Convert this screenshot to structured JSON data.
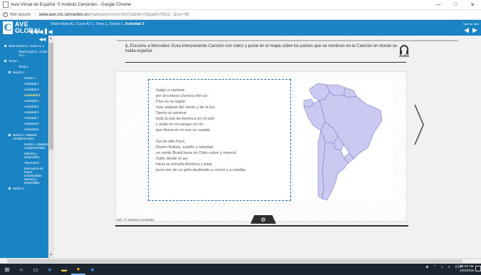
{
  "browser": {
    "window_title": "Aula Virtual de Español. © Instituto Cervantes - Google Chrome",
    "security_label": "Not secure",
    "url_host": "www.ave.cvc.cervantes.es",
    "url_path": "/materiales/visor.htm?admin=0&path=5612...&cur=80"
  },
  "ave": {
    "logo_c": "C",
    "logo_ave": "AVE",
    "logo_global": "GLOBAL",
    "breadcrumb": "Nivel inicial A1, Curso A1 1, Tema 1, Sesión 1,",
    "breadcrumb_current": "Actividad 3",
    "session_label": "Salir de esta"
  },
  "sidebar": {
    "collapse": "◀◀",
    "items": [
      {
        "label": "Nivel inicial A1, Curso A1 1",
        "level": 0
      },
      {
        "label": "Nivel inicial A1, Curso A1 1",
        "level": 2
      },
      {
        "label": "Tema 1",
        "level": 0
      },
      {
        "label": "Tema 1",
        "level": 2
      },
      {
        "label": "Sesión 1",
        "level": 1
      },
      {
        "label": "Sesión 1",
        "level": 3
      },
      {
        "label": "Actividad 1",
        "level": 3
      },
      {
        "label": "Actividad 2",
        "level": 3
      },
      {
        "label": "Actividad 3",
        "level": 3
      },
      {
        "label": "Actividad 4",
        "level": 3
      },
      {
        "label": "Actividad 5",
        "level": 3
      },
      {
        "label": "Actividad 6",
        "level": 3
      },
      {
        "label": "Actividad 7",
        "level": 3
      },
      {
        "label": "Actividad 8",
        "level": 3
      },
      {
        "label": "Actividad 9",
        "level": 3
      },
      {
        "label": "Sesión 1. Material complementario",
        "level": 1
      },
      {
        "label": "Sesión 1. Material complementario",
        "level": 3
      },
      {
        "label": "Saludos y despedidas",
        "level": 3
      },
      {
        "label": "Abecedario",
        "level": 3
      },
      {
        "label": "Entonación de frases exclamativas: saludos y despedidas",
        "level": 3
      },
      {
        "label": "Sesión 2",
        "level": 1
      }
    ]
  },
  "activity": {
    "number": "1.",
    "instruction_a": "Escuche a Mercedes Sosa interpretando",
    "instruction_song": "Canción con todos",
    "instruction_b": "y pulse en el mapa sobre los países que se nombran en la Canción en donde se habla español.",
    "audio_label": "Audio",
    "poem": [
      "Salgo a caminar",
      "por la cintura cósmica del sur.",
      "Piso en la región",
      "más vegetal del viento y de la luz.",
      "Siento al caminar",
      "toda la piel de América en mi piel",
      "y anda en mi sangre un río",
      "que libera en mi voz su caudal.",
      "",
      "Sol de alto Perú,",
      "Rostro Bolivia, estaño y soledad,",
      "un verde Brasil besa mi Chile cobre y mineral.",
      "Subo desde el sur",
      "hacia la entraña América y total,",
      "pura raíz de un grito destinado a crecer y a estallar."
    ],
    "credit": "Ref.: © Instituto Cervantes"
  },
  "taskbar": {
    "lang": "ESP",
    "time": "11:23 AM",
    "date": "4/26/2018"
  },
  "colors": {
    "ave_blue": "#1a83c4",
    "map_fill": "#c9c9f2",
    "map_stroke": "#7c7cc9"
  }
}
